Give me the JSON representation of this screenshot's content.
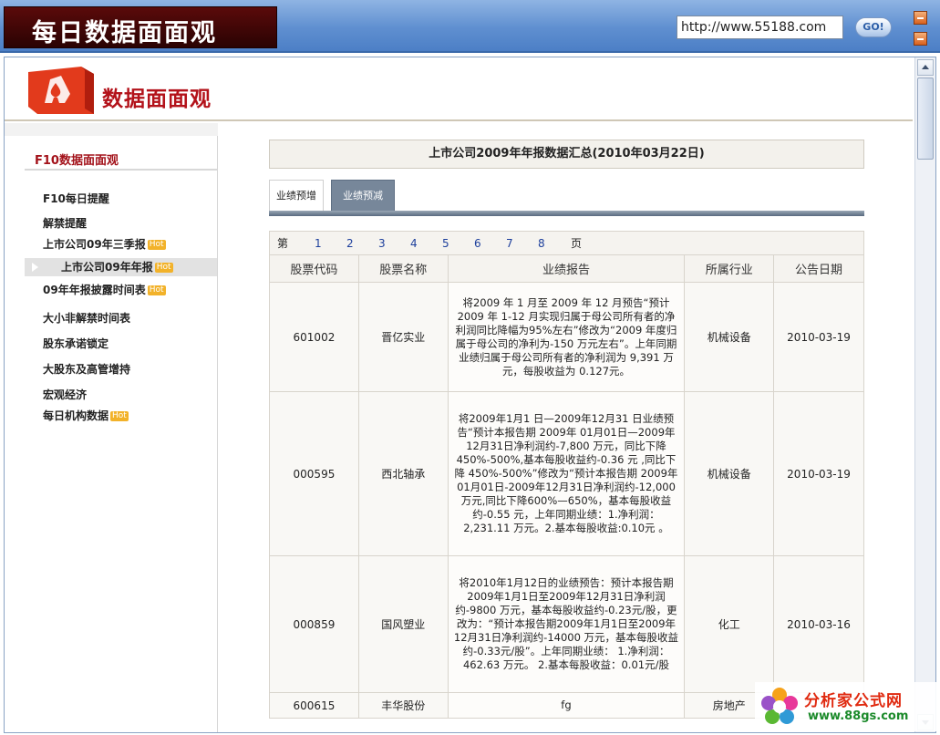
{
  "app": {
    "title": "每日数据面面观"
  },
  "browser": {
    "url": "http://www.55188.com",
    "go_label": "GO!"
  },
  "site": {
    "title": "数据面面观"
  },
  "sidebar": {
    "heading": "F10数据面面观",
    "items": [
      {
        "label": "F10每日提醒",
        "hot": false,
        "active": false
      },
      {
        "label": "解禁提醒",
        "hot": false,
        "active": false
      },
      {
        "label": "上市公司09年三季报",
        "hot": true,
        "active": false
      },
      {
        "label": "上市公司09年年报",
        "hot": true,
        "active": true
      },
      {
        "label": "09年年报披露时间表",
        "hot": true,
        "active": false
      },
      {
        "label": "大小非解禁时间表",
        "hot": false,
        "active": false
      },
      {
        "label": "股东承诺锁定",
        "hot": false,
        "active": false
      },
      {
        "label": "大股东及高管增持",
        "hot": false,
        "active": false
      },
      {
        "label": "宏观经济",
        "hot": false,
        "active": false
      },
      {
        "label": "每日机构数据",
        "hot": true,
        "active": false
      }
    ],
    "hot_label": "Hot"
  },
  "report": {
    "title": "上市公司2009年年报数据汇总(2010年03月22日)",
    "tabs": [
      {
        "label": "业绩预增"
      },
      {
        "label": "业绩预减"
      }
    ],
    "pager": {
      "prefix": "第",
      "pages": [
        "1",
        "2",
        "3",
        "4",
        "5",
        "6",
        "7",
        "8"
      ],
      "suffix": "页"
    },
    "columns": [
      "股票代码",
      "股票名称",
      "业绩报告",
      "所属行业",
      "公告日期"
    ],
    "rows": [
      {
        "code": "601002",
        "name": "晋亿实业",
        "report": "将2009 年 1 月至 2009 年 12 月预告“预计 2009 年 1-12 月实现归属于母公司所有者的净利润同比降幅为95%左右”修改为“2009 年度归属于母公司的净利为-150 万元左右”。上年同期业绩归属于母公司所有者的净利润为 9,391 万元，每股收益为 0.127元。",
        "industry": "机械设备",
        "date": "2010-03-19"
      },
      {
        "code": "000595",
        "name": "西北轴承",
        "report": "将2009年1月1 日—2009年12月31 日业绩预告“预计本报告期 2009年 01月01日—2009年12月31日净利润约-7,800 万元，同比下降450%-500%,基本每股收益约-0.36 元 ,同比下降 450%-500%”修改为“预计本报告期 2009年 01月01日-2009年12月31日净利润约-12,000万元,同比下降600%—650%，基本每股收益约-0.55 元，上年同期业绩：1.净利润：2,231.11 万元。2.基本每股收益:0.10元 。",
        "industry": "机械设备",
        "date": "2010-03-19"
      },
      {
        "code": "000859",
        "name": "国风塑业",
        "report": "将2010年1月12日的业绩预告：预计本报告期2009年1月1日至2009年12月31日净利润约-9800 万元，基本每股收益约-0.23元/股，更改为：“预计本报告期2009年1月1日至2009年12月31日净利润约-14000 万元，基本每股收益约-0.33元/股”。上年同期业绩： 1.净利润：462.63 万元。 2.基本每股收益：0.01元/股",
        "industry": "化工",
        "date": "2010-03-16"
      },
      {
        "code": "600615",
        "name": "丰华股份",
        "report": "fg",
        "industry": "房地产",
        "date": ""
      }
    ]
  },
  "watermark": {
    "text": "分析家公式网",
    "url": "www.88gs.com"
  },
  "colors": {
    "title_bg": "#3a0505",
    "accent_red": "#b3121a",
    "link_blue": "#1d3f9c",
    "active_tab": "#77879a"
  }
}
